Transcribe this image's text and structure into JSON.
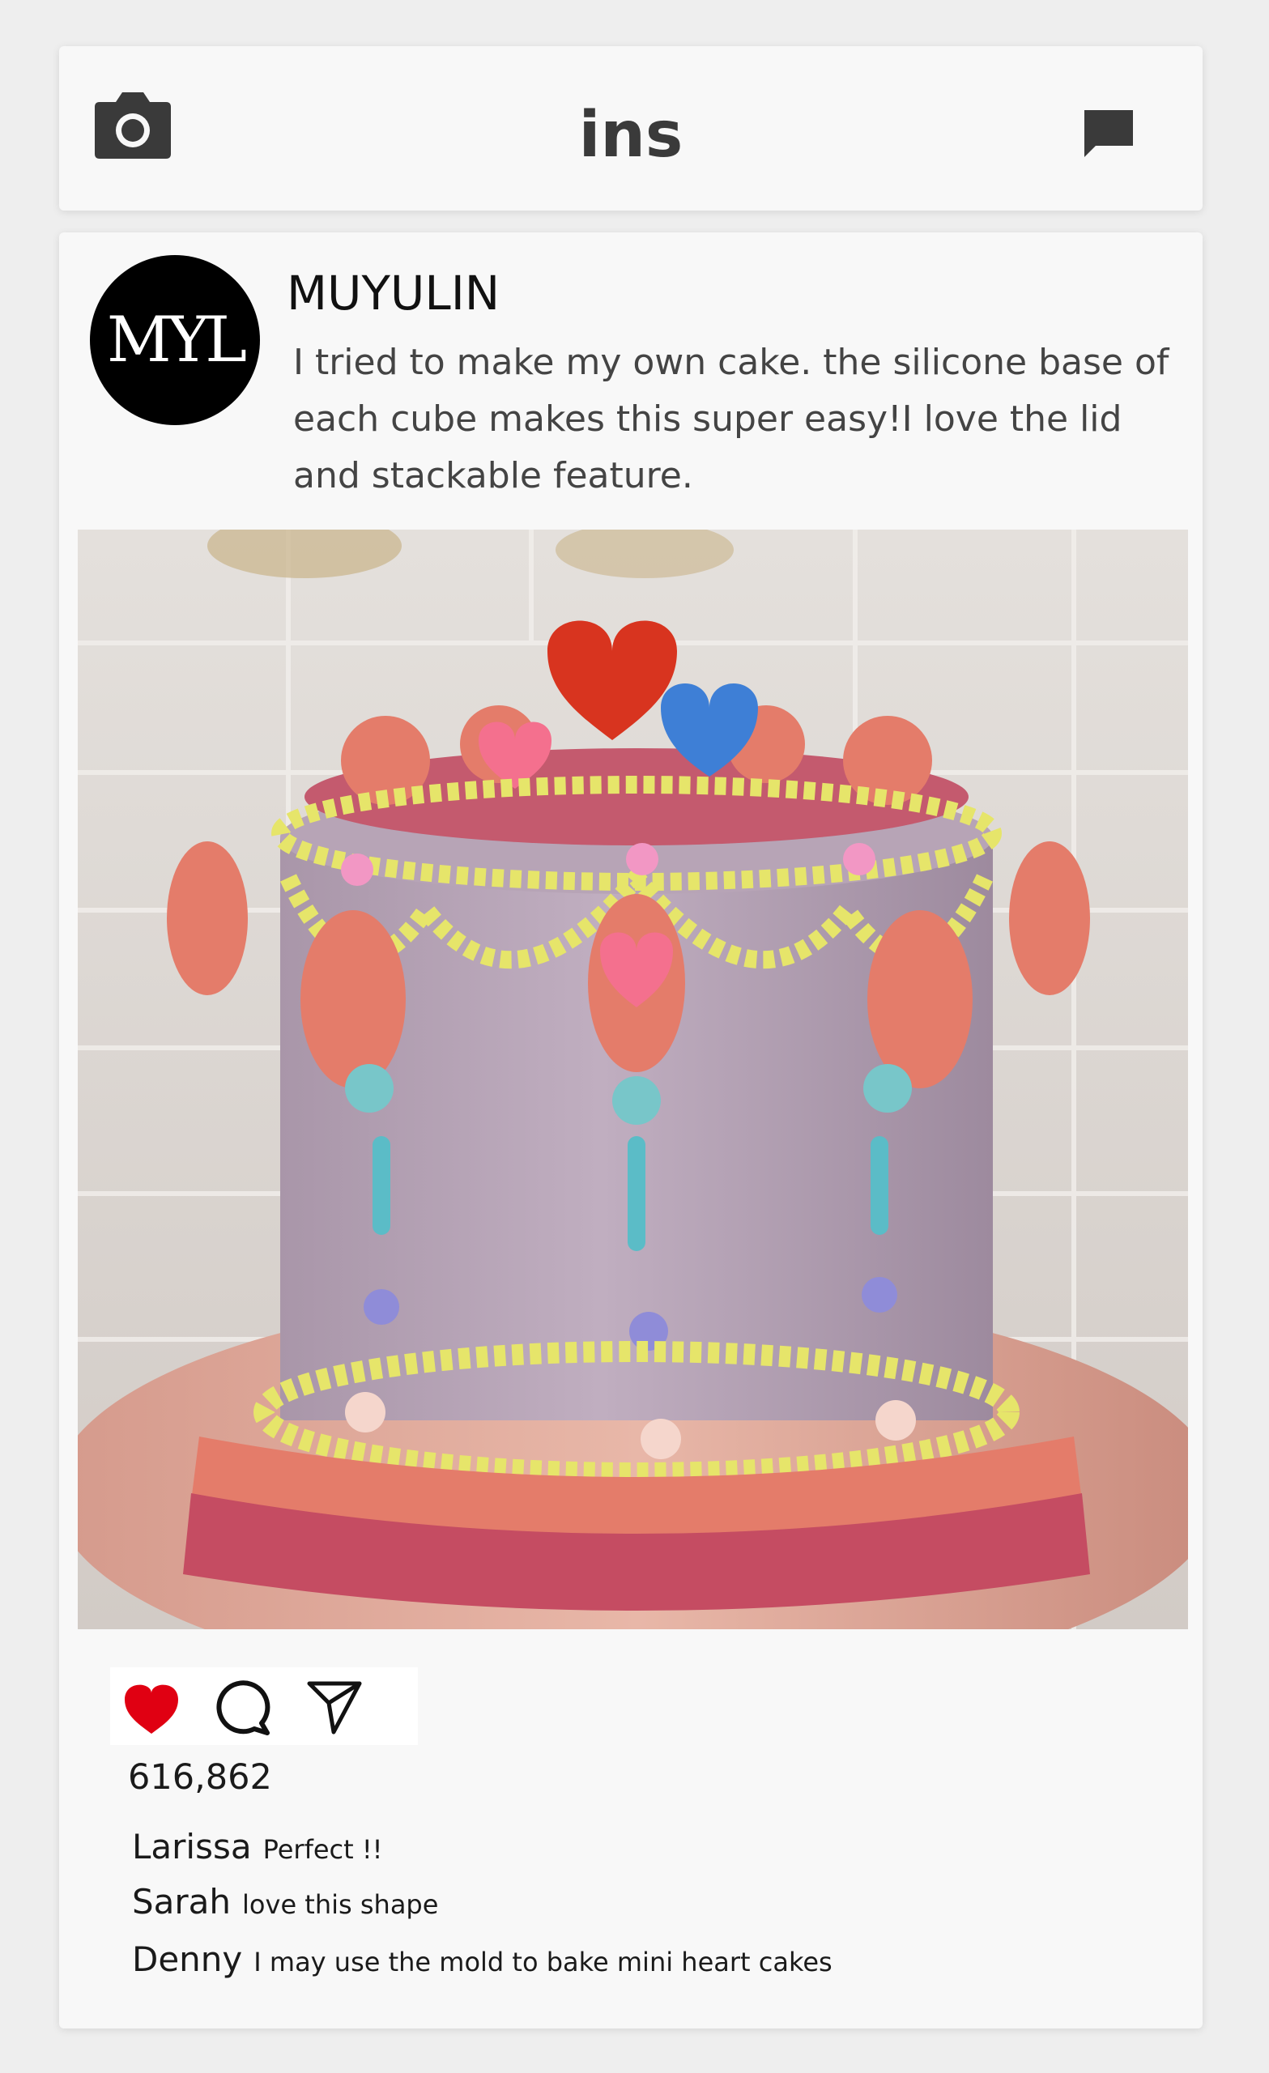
{
  "app": {
    "title": "ins"
  },
  "icons": {
    "camera": "camera-icon",
    "messages": "message-icon",
    "like": "heart-icon",
    "comment": "comment-bubble-icon",
    "share": "send-icon"
  },
  "post": {
    "avatar_text": "MYL",
    "username": "MUYULIN",
    "caption": "I tried to make my own cake. the silicone base of each cube makes this super easy!I love the lid and stackable feature.",
    "image_description": "purple vintage-style cake with coral, yellow and pink piping",
    "likes": "616,862",
    "liked": true,
    "comments": [
      {
        "author": "Larissa",
        "text": "Perfect !!"
      },
      {
        "author": "Sarah",
        "text": "love this shape"
      },
      {
        "author": "Denny",
        "text": "I may use the mold to bake mini heart cakes"
      }
    ]
  },
  "colors": {
    "background": "#eeeeee",
    "card": "#f8f8f8",
    "like_red": "#e00012",
    "icon_dark": "#3a3a3a"
  }
}
